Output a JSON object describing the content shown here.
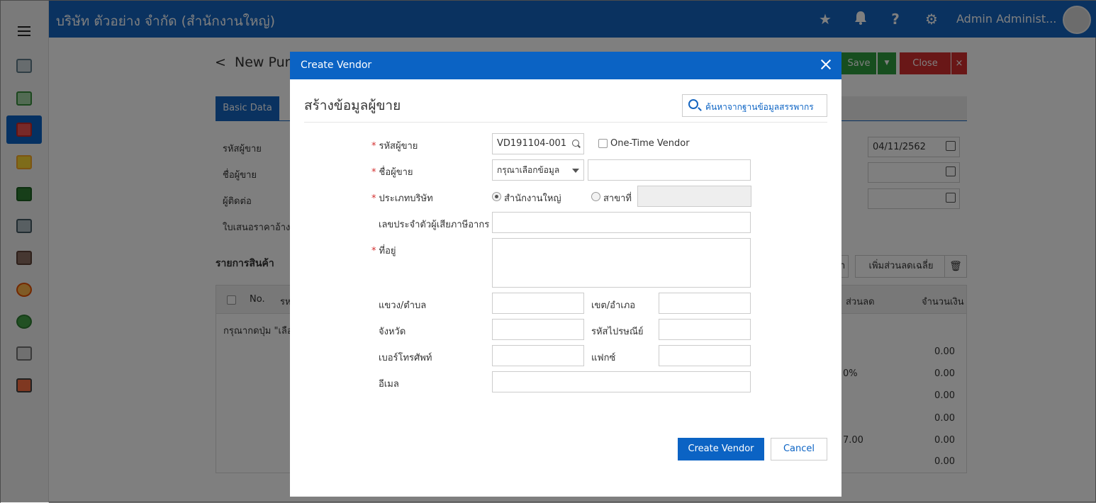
{
  "app": {
    "company": "บริษัท ตัวอย่าง จำกัด (สำนักงานใหญ่)",
    "admin_name": "Admin Administ...",
    "page_title": "New Purc",
    "save_label": "Save",
    "close_label": "Close",
    "tab_basic": "Basic Data",
    "labels": [
      "รหัสผู้ขาย",
      "ชื่อผู้ขาย",
      "ผู้ติดต่อ",
      "ใบเสนอราคาอ้างอิ"
    ],
    "date_value": "04/11/2562",
    "section_title": "รายการสินค้า",
    "add_discount_label": "เพิ่มส่วนลดเฉลี่ย",
    "table_headers": [
      "No.",
      "รห",
      "ส่วนลด",
      "จำนวนเงิน"
    ],
    "empty_hint": "กรุณากดปุ่ม \"เลือ",
    "amounts": [
      "0.00",
      "0.00",
      "0.00",
      "0.00",
      "0.00",
      "0.00"
    ],
    "percent_fragment": "0%",
    "amount_fragment": "7.00",
    "blank_btn": "า"
  },
  "modal": {
    "title": "Create Vendor",
    "heading": "สร้างข้อมูลผู้ขาย",
    "search_label": "ค้นหาจากฐานข้อมูลสรรพากร",
    "required_mark": "*",
    "fields": {
      "vendor_code_label": "รหัสผู้ขาย",
      "vendor_code_value": "VD191104-001",
      "one_time_label": "One-Time Vendor",
      "vendor_name_label": "ชื่อผู้ขาย",
      "vendor_name_select": "กรุณาเลือกข้อมูล",
      "company_type_label": "ประเภทบริษัท",
      "head_office_label": "สำนักงานใหญ่",
      "branch_label": "สาขาที่",
      "tax_id_label": "เลขประจำตัวผู้เสียภาษีอากร",
      "address_label": "ที่อยู่",
      "subdistrict_label": "แขวง/ตำบล",
      "district_label": "เขต/อำเภอ",
      "province_label": "จังหวัด",
      "postcode_label": "รหัสไปรษณีย์",
      "phone_label": "เบอร์โทรศัพท์",
      "fax_label": "แฟกซ์",
      "email_label": "อีเมล"
    },
    "create_label": "Create Vendor",
    "cancel_label": "Cancel"
  },
  "colors": {
    "primary": "#0b63c4",
    "topbar": "#1565c0",
    "save_green": "#2e9c3e",
    "close_red": "#d32f2f",
    "required": "#d32f2f"
  },
  "icons": [
    "hamburger-icon",
    "star-icon",
    "bell-icon",
    "help-icon",
    "gear-icon",
    "search-icon",
    "calendar-icon",
    "trash-icon",
    "close-icon",
    "caret-down-icon"
  ]
}
